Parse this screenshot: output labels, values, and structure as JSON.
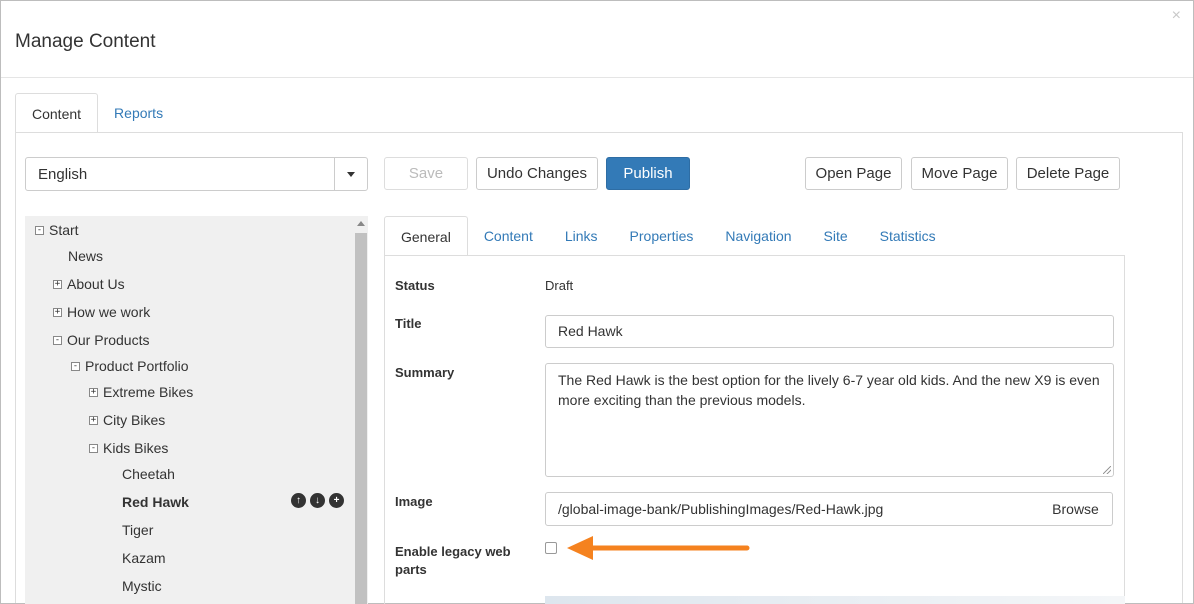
{
  "dialog": {
    "title": "Manage Content",
    "close_glyph": "×"
  },
  "top_tabs": [
    {
      "label": "Content",
      "active": true
    },
    {
      "label": "Reports",
      "active": false
    }
  ],
  "language": {
    "selected": "English"
  },
  "toolbar": {
    "save_label": "Save",
    "undo_label": "Undo Changes",
    "publish_label": "Publish",
    "open_label": "Open Page",
    "move_label": "Move Page",
    "delete_label": "Delete Page"
  },
  "tree": {
    "nodes": [
      {
        "label": "Start",
        "toggle": "-"
      },
      {
        "label": "News",
        "toggle": ""
      },
      {
        "label": "About Us",
        "toggle": "+"
      },
      {
        "label": "How we work",
        "toggle": "+"
      },
      {
        "label": "Our Products",
        "toggle": "-"
      },
      {
        "label": "Product Portfolio",
        "toggle": "-"
      },
      {
        "label": "Extreme Bikes",
        "toggle": "+"
      },
      {
        "label": "City Bikes",
        "toggle": "+"
      },
      {
        "label": "Kids Bikes",
        "toggle": "-"
      },
      {
        "label": "Cheetah",
        "toggle": ""
      },
      {
        "label": "Red Hawk",
        "toggle": "",
        "selected": true
      },
      {
        "label": "Tiger",
        "toggle": ""
      },
      {
        "label": "Kazam",
        "toggle": ""
      },
      {
        "label": "Mystic",
        "toggle": ""
      }
    ]
  },
  "sub_tabs": [
    {
      "label": "General",
      "active": true
    },
    {
      "label": "Content"
    },
    {
      "label": "Links"
    },
    {
      "label": "Properties"
    },
    {
      "label": "Navigation"
    },
    {
      "label": "Site"
    },
    {
      "label": "Statistics"
    }
  ],
  "form": {
    "status_label": "Status",
    "status_value": "Draft",
    "title_label": "Title",
    "title_value": "Red Hawk",
    "summary_label": "Summary",
    "summary_value": "The Red Hawk is the best option for the lively 6-7 year old kids. And the new X9 is even more exciting than the previous models.",
    "image_label": "Image",
    "image_value": "/global-image-bank/PublishingImages/Red-Hawk.jpg",
    "browse_label": "Browse",
    "legacy_label": "Enable legacy web parts",
    "legacy_checked": false
  },
  "colors": {
    "accent": "#337ab7",
    "annotation_arrow": "#f5821f"
  }
}
